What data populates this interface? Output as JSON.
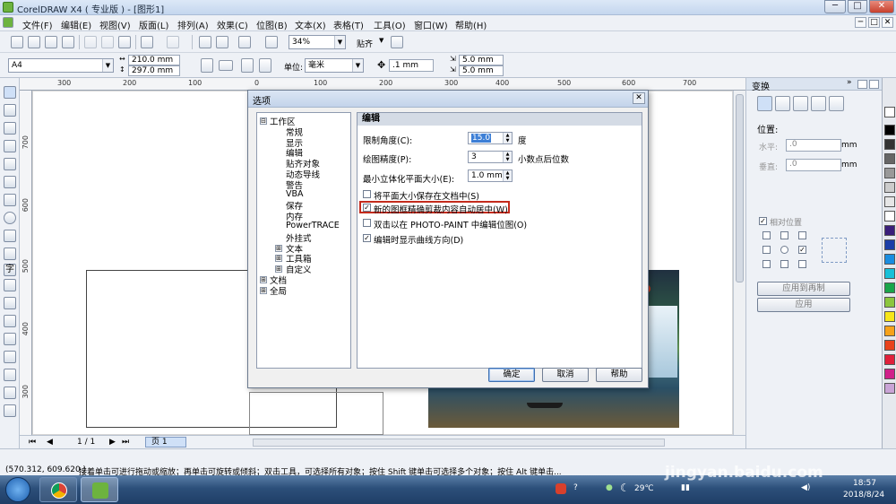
{
  "window": {
    "title": "CorelDRAW X4 ( 专业版 ) - [图形1]",
    "controls": [
      "─",
      "□",
      "✕"
    ]
  },
  "menu": {
    "items": [
      "文件(F)",
      "编辑(E)",
      "视图(V)",
      "版面(L)",
      "排列(A)",
      "效果(C)",
      "位图(B)",
      "文本(X)",
      "表格(T)",
      "工具(O)",
      "窗口(W)",
      "帮助(H)"
    ]
  },
  "toolbar": {
    "zoom": "34%",
    "snap": "贴齐"
  },
  "propbar": {
    "paper": "A4",
    "width": "210.0 mm",
    "height": "297.0 mm",
    "unit_label": "单位:",
    "unit": "毫米",
    "nudge": ".1 mm",
    "dup_x": "5.0 mm",
    "dup_y": "5.0 mm"
  },
  "rulers": {
    "h": [
      "300",
      "200",
      "100",
      "0",
      "100",
      "200",
      "300",
      "400",
      "500",
      "600",
      "700"
    ],
    "v": [
      "700",
      "600",
      "500",
      "400",
      "300"
    ]
  },
  "page_nav": {
    "counter": "1 / 1",
    "tab": "页 1"
  },
  "docker": {
    "title": "变换",
    "position_label": "位置:",
    "h_label": "水平:",
    "h_value": ".0",
    "v_label": "垂直:",
    "v_value": ".0",
    "unit": "mm",
    "relative_label": "相对位置",
    "apply_dup": "应用到再制",
    "apply": "应用"
  },
  "status": {
    "coords": "(570.312, 609.620 )",
    "hint": "接着单击可进行拖动或缩放；再单击可旋转或倾斜；双击工具，可选择所有对象；按住 Shift 键单击可选择多个对象；按住 Alt 键单击..."
  },
  "dialog": {
    "title": "选项",
    "close": "✕",
    "tree": [
      {
        "label": "工作区",
        "expander": "⊟",
        "level": 0
      },
      {
        "label": "常规",
        "level": 1
      },
      {
        "label": "显示",
        "level": 1
      },
      {
        "label": "编辑",
        "level": 1
      },
      {
        "label": "贴齐对象",
        "level": 1
      },
      {
        "label": "动态导线",
        "level": 1
      },
      {
        "label": "警告",
        "level": 1
      },
      {
        "label": "VBA",
        "level": 1
      },
      {
        "label": "保存",
        "level": 1
      },
      {
        "label": "内存",
        "level": 1
      },
      {
        "label": "PowerTRACE",
        "level": 1
      },
      {
        "label": "外挂式",
        "level": 1
      },
      {
        "label": "文本",
        "expander": "⊞",
        "level": 1
      },
      {
        "label": "工具箱",
        "expander": "⊞",
        "level": 1
      },
      {
        "label": "自定义",
        "expander": "⊞",
        "level": 1
      },
      {
        "label": "文档",
        "expander": "⊞",
        "level": 0
      },
      {
        "label": "全局",
        "expander": "⊞",
        "level": 0
      }
    ],
    "panel": {
      "heading": "编辑",
      "constrain_label": "限制角度(C):",
      "constrain_value": "15.0",
      "constrain_unit": "度",
      "precision_label": "绘图精度(P):",
      "precision_value": "3",
      "precision_unit": "小数点后位数",
      "extrude_label": "最小立体化平面大小(E):",
      "extrude_value": "1.0 mm",
      "checks": [
        {
          "label": "将平面大小保存在文档中(S)",
          "checked": false
        },
        {
          "label": "新的图框精确剪裁内容自动居中(W)",
          "checked": true
        },
        {
          "label": "双击以在 PHOTO-PAINT 中编辑位图(O)",
          "checked": false
        },
        {
          "label": "编辑时显示曲线方向(D)",
          "checked": true
        }
      ]
    },
    "buttons": {
      "ok": "确定",
      "cancel": "取消",
      "help": "帮助"
    }
  },
  "taskbar": {
    "weather": "29℃",
    "time": "18:57",
    "date": "2018/8/24",
    "watermark": "jingyan.baidu.com"
  },
  "colors": {
    "highlight": "#c42b1c",
    "selection": "#3d7fd6"
  }
}
